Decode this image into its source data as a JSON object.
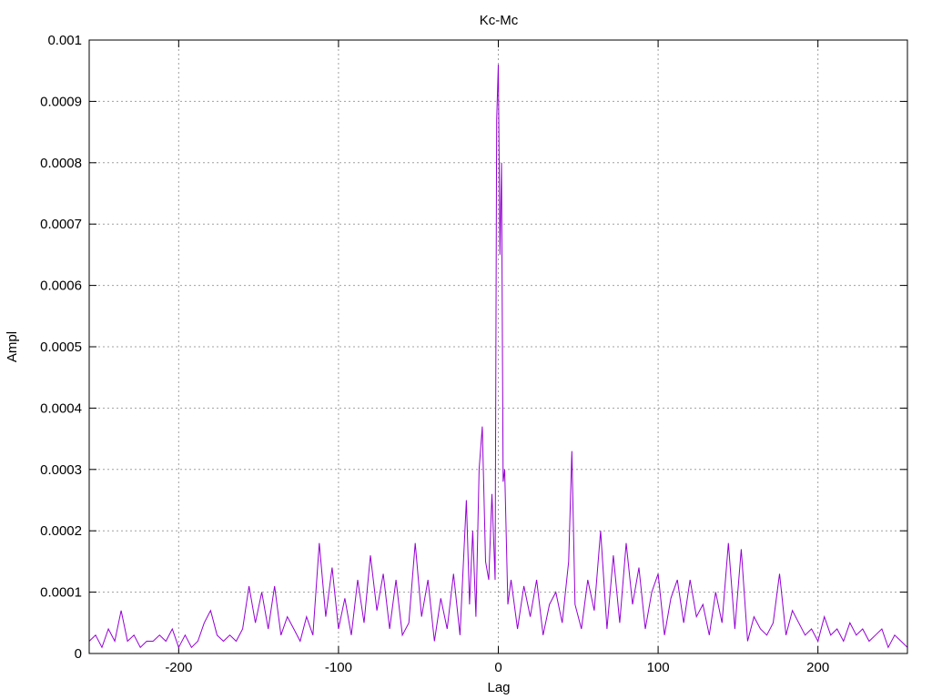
{
  "chart_data": {
    "type": "line",
    "title": "Kc-Mc",
    "xlabel": "Lag",
    "ylabel": "Ampl",
    "xlim": [
      -256,
      256
    ],
    "ylim": [
      0,
      0.001
    ],
    "xticks": [
      -200,
      -100,
      0,
      100,
      200
    ],
    "xtick_labels": [
      "-200",
      "-100",
      "0",
      "100",
      "200"
    ],
    "yticks": [
      0,
      0.0001,
      0.0002,
      0.0003,
      0.0004,
      0.0005,
      0.0006,
      0.0007,
      0.0008,
      0.0009,
      0.001
    ],
    "ytick_labels": [
      "0",
      "0.0001",
      "0.0002",
      "0.0003",
      "0.0004",
      "0.0005",
      "0.0006",
      "0.0007",
      "0.0008",
      "0.0009",
      "0.001"
    ],
    "grid": true,
    "series_color": "#9400d3",
    "series": [
      {
        "name": "Kc-Mc",
        "points": [
          [
            -256,
            2e-05
          ],
          [
            -252,
            3e-05
          ],
          [
            -248,
            1e-05
          ],
          [
            -244,
            4e-05
          ],
          [
            -240,
            2e-05
          ],
          [
            -236,
            7e-05
          ],
          [
            -232,
            2e-05
          ],
          [
            -228,
            3e-05
          ],
          [
            -224,
            1e-05
          ],
          [
            -220,
            2e-05
          ],
          [
            -216,
            2e-05
          ],
          [
            -212,
            3e-05
          ],
          [
            -208,
            2e-05
          ],
          [
            -204,
            4e-05
          ],
          [
            -200,
            1e-05
          ],
          [
            -196,
            3e-05
          ],
          [
            -192,
            1e-05
          ],
          [
            -188,
            2e-05
          ],
          [
            -184,
            5e-05
          ],
          [
            -180,
            7e-05
          ],
          [
            -176,
            3e-05
          ],
          [
            -172,
            2e-05
          ],
          [
            -168,
            3e-05
          ],
          [
            -164,
            2e-05
          ],
          [
            -160,
            4e-05
          ],
          [
            -156,
            0.00011
          ],
          [
            -152,
            5e-05
          ],
          [
            -148,
            0.0001
          ],
          [
            -144,
            4e-05
          ],
          [
            -140,
            0.00011
          ],
          [
            -136,
            3e-05
          ],
          [
            -132,
            6e-05
          ],
          [
            -128,
            4e-05
          ],
          [
            -124,
            2e-05
          ],
          [
            -120,
            6e-05
          ],
          [
            -116,
            3e-05
          ],
          [
            -112,
            0.00018
          ],
          [
            -108,
            6e-05
          ],
          [
            -104,
            0.00014
          ],
          [
            -100,
            4e-05
          ],
          [
            -96,
            9e-05
          ],
          [
            -92,
            3e-05
          ],
          [
            -88,
            0.00012
          ],
          [
            -84,
            5e-05
          ],
          [
            -80,
            0.00016
          ],
          [
            -76,
            7e-05
          ],
          [
            -72,
            0.00013
          ],
          [
            -68,
            4e-05
          ],
          [
            -64,
            0.00012
          ],
          [
            -60,
            3e-05
          ],
          [
            -56,
            5e-05
          ],
          [
            -52,
            0.00018
          ],
          [
            -48,
            6e-05
          ],
          [
            -44,
            0.00012
          ],
          [
            -40,
            2e-05
          ],
          [
            -36,
            9e-05
          ],
          [
            -32,
            4e-05
          ],
          [
            -28,
            0.00013
          ],
          [
            -24,
            3e-05
          ],
          [
            -20,
            0.00025
          ],
          [
            -18,
            8e-05
          ],
          [
            -16,
            0.0002
          ],
          [
            -14,
            6e-05
          ],
          [
            -12,
            0.0003
          ],
          [
            -10,
            0.00037
          ],
          [
            -8,
            0.00015
          ],
          [
            -6,
            0.00012
          ],
          [
            -4,
            0.00026
          ],
          [
            -2,
            0.00012
          ],
          [
            -1,
            0.00087
          ],
          [
            0,
            0.00096
          ],
          [
            1,
            0.00065
          ],
          [
            2,
            0.0008
          ],
          [
            3,
            0.00028
          ],
          [
            4,
            0.0003
          ],
          [
            6,
            8e-05
          ],
          [
            8,
            0.00012
          ],
          [
            12,
            4e-05
          ],
          [
            16,
            0.00011
          ],
          [
            20,
            6e-05
          ],
          [
            24,
            0.00012
          ],
          [
            28,
            3e-05
          ],
          [
            32,
            8e-05
          ],
          [
            36,
            0.0001
          ],
          [
            40,
            5e-05
          ],
          [
            44,
            0.00015
          ],
          [
            46,
            0.00033
          ],
          [
            48,
            8e-05
          ],
          [
            52,
            4e-05
          ],
          [
            56,
            0.00012
          ],
          [
            60,
            7e-05
          ],
          [
            64,
            0.0002
          ],
          [
            68,
            4e-05
          ],
          [
            72,
            0.00016
          ],
          [
            76,
            5e-05
          ],
          [
            80,
            0.00018
          ],
          [
            84,
            8e-05
          ],
          [
            88,
            0.00014
          ],
          [
            92,
            4e-05
          ],
          [
            96,
            0.0001
          ],
          [
            100,
            0.00013
          ],
          [
            104,
            3e-05
          ],
          [
            108,
            9e-05
          ],
          [
            112,
            0.00012
          ],
          [
            116,
            5e-05
          ],
          [
            120,
            0.00012
          ],
          [
            124,
            6e-05
          ],
          [
            128,
            8e-05
          ],
          [
            132,
            3e-05
          ],
          [
            136,
            0.0001
          ],
          [
            140,
            5e-05
          ],
          [
            144,
            0.00018
          ],
          [
            148,
            4e-05
          ],
          [
            152,
            0.00017
          ],
          [
            156,
            2e-05
          ],
          [
            160,
            6e-05
          ],
          [
            164,
            4e-05
          ],
          [
            168,
            3e-05
          ],
          [
            172,
            5e-05
          ],
          [
            176,
            0.00013
          ],
          [
            180,
            3e-05
          ],
          [
            184,
            7e-05
          ],
          [
            188,
            5e-05
          ],
          [
            192,
            3e-05
          ],
          [
            196,
            4e-05
          ],
          [
            200,
            2e-05
          ],
          [
            204,
            6e-05
          ],
          [
            208,
            3e-05
          ],
          [
            212,
            4e-05
          ],
          [
            216,
            2e-05
          ],
          [
            220,
            5e-05
          ],
          [
            224,
            3e-05
          ],
          [
            228,
            4e-05
          ],
          [
            232,
            2e-05
          ],
          [
            236,
            3e-05
          ],
          [
            240,
            4e-05
          ],
          [
            244,
            1e-05
          ],
          [
            248,
            3e-05
          ],
          [
            252,
            2e-05
          ],
          [
            256,
            1e-05
          ]
        ]
      }
    ]
  }
}
